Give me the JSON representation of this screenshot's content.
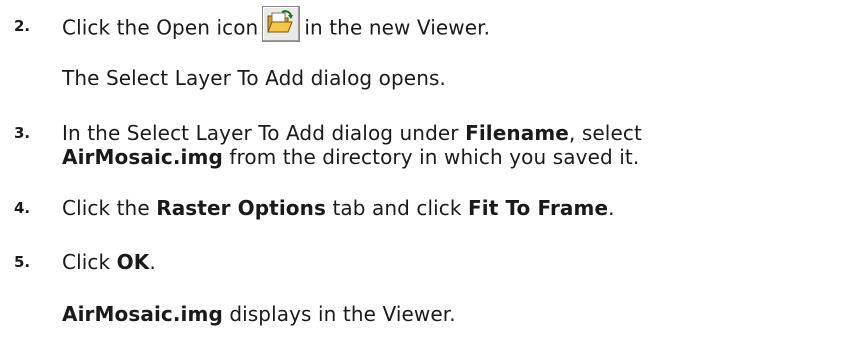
{
  "steps": [
    {
      "number": "2.",
      "before_icon": "Click the Open icon",
      "icon": "folder-open-icon",
      "after_icon": "in the new Viewer.",
      "note": "The Select Layer To Add dialog opens."
    },
    {
      "number": "3.",
      "line1_a": "In the Select Layer To Add dialog under ",
      "line1_b": "Filename",
      "line1_c": ", select",
      "line2_a": "AirMosaic.img",
      "line2_b": " from the directory in which you saved it."
    },
    {
      "number": "4.",
      "a": "Click the ",
      "b": "Raster Options",
      "c": " tab and click ",
      "d": "Fit To Frame",
      "e": "."
    },
    {
      "number": "5.",
      "a": "Click ",
      "b": "OK",
      "c": ".",
      "result_a": "AirMosaic.img",
      "result_b": " displays in the Viewer."
    }
  ]
}
